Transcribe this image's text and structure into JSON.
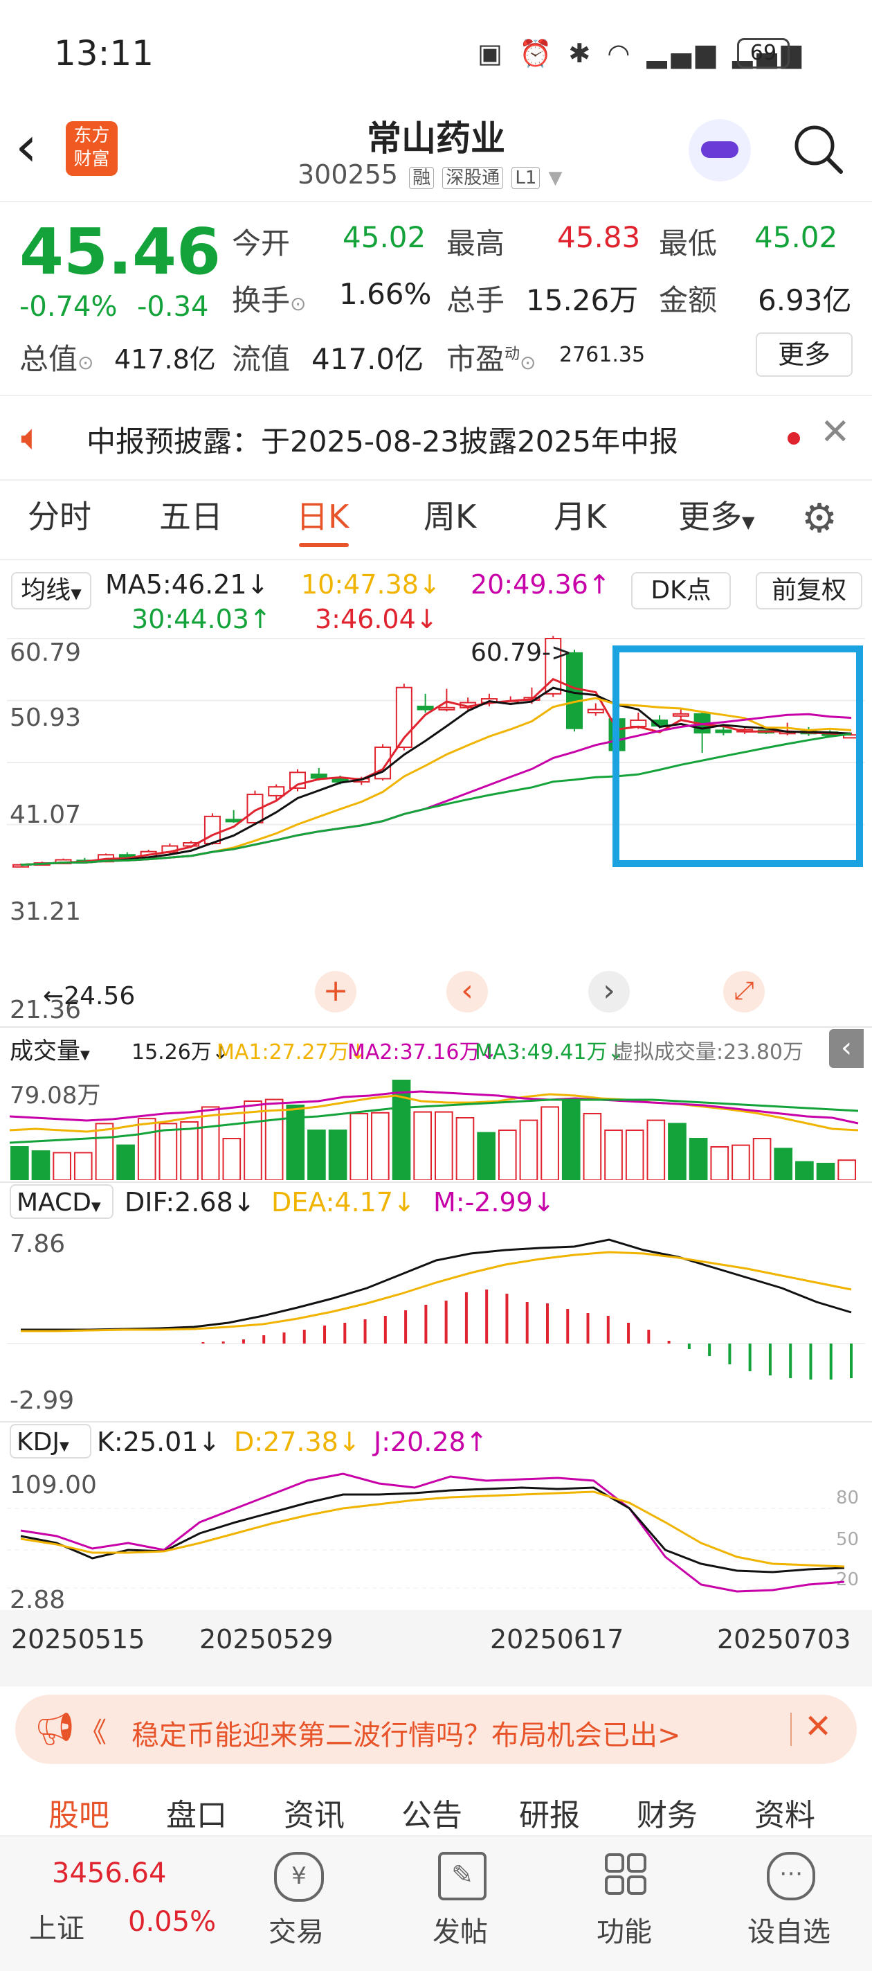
{
  "status": {
    "time": "13:11",
    "battery": "69"
  },
  "header": {
    "brand": "东方\n财富",
    "brand_line1": "东方",
    "brand_line2": "财富",
    "title": "常山药业",
    "code": "300255",
    "tags": [
      "融",
      "深股通",
      "L1"
    ]
  },
  "quote": {
    "price": "45.46",
    "change_pct": "-0.74%",
    "change": "-0.34",
    "open_label": "今开",
    "open": "45.02",
    "high_label": "最高",
    "high": "45.83",
    "low_label": "最低",
    "low": "45.02",
    "turnover_label": "换手",
    "turnover": "1.66%",
    "volume_label": "总手",
    "volume": "15.26万",
    "amount_label": "金额",
    "amount": "6.93亿",
    "mcap_label": "总值",
    "mcap": "417.8亿",
    "float_label": "流值",
    "float": "417.0亿",
    "pe_label": "市盈",
    "pe_sup": "动",
    "pe": "2761.35",
    "more": "更多"
  },
  "notice": {
    "text": "中报预披露：于2025-08-23披露2025年中报"
  },
  "tabs": [
    "分时",
    "五日",
    "日K",
    "周K",
    "月K",
    "更多"
  ],
  "ma": {
    "selector": "均线",
    "ma5": "MA5:46.21",
    "ma10": "10:47.38",
    "ma20": "20:49.36",
    "ma30": "30:44.03",
    "ma3": "3:46.04",
    "dk": "DK点",
    "fq": "前复权"
  },
  "kline": {
    "y_labels": [
      "60.79",
      "50.93",
      "41.07",
      "31.21",
      "21.36"
    ],
    "max_label": "60.79->",
    "min_label": "24.56"
  },
  "volume_panel": {
    "selector": "成交量",
    "vol": "15.26万",
    "ma1": "MA1:27.27万",
    "ma2": "MA2:37.16万",
    "ma3": "MA3:49.41万",
    "virtual": "虚拟成交量:23.80万",
    "y_max": "79.08万"
  },
  "macd": {
    "selector": "MACD",
    "dif": "DIF:2.68",
    "dea": "DEA:4.17",
    "m": "M:-2.99",
    "y_max": "7.86",
    "y_min": "-2.99"
  },
  "kdj": {
    "selector": "KDJ",
    "k": "K:25.01",
    "d": "D:27.38",
    "j": "J:20.28",
    "y_max": "109.00",
    "y_min": "2.88",
    "right_ticks": [
      "80",
      "50",
      "20"
    ]
  },
  "dates": [
    "20250515",
    "20250529",
    "20250617",
    "20250703"
  ],
  "ad": {
    "text": "稳定币能迎来第二波行情吗？布局机会已出>"
  },
  "bottom_tabs": [
    "股吧",
    "盘口",
    "资讯",
    "公告",
    "研报",
    "财务",
    "资料"
  ],
  "bottom_nav": {
    "index_value": "3456.64",
    "index_name": "上证",
    "index_change": "0.05%",
    "items": [
      "交易",
      "发帖",
      "功能",
      "设自选"
    ]
  },
  "colors": {
    "up": "#e0242f",
    "down": "#14a33a",
    "accent": "#e8542a",
    "highlight": "#1aa3e0"
  }
}
